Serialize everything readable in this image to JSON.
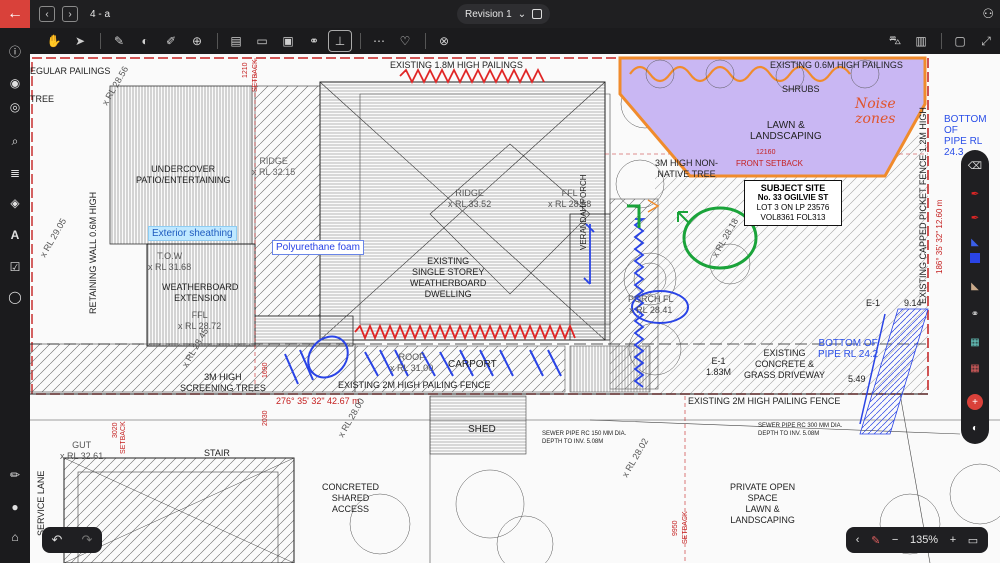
{
  "header": {
    "page_label": "4 - a",
    "revision_label": "Revision 1"
  },
  "plan": {
    "labels": {
      "existing_fence_top": "EXISTING 1.8M HIGH PAILINGS",
      "regular_pailings": "EGULAR PAILINGS",
      "tree": "TREE",
      "existing_fence_top_right": "EXISTING 0.6M HIGH PAILINGS",
      "shrubs": "SHRUBS",
      "lawn": "LAWN &\nLANDSCAPING",
      "front_setback": "FRONT SETBACK",
      "front_setback_dim": "12160",
      "non_native_tree": "3M HIGH NON-\nNATIVE TREE",
      "undercover": "UNDERCOVER\nPATIO/ENTERTAINING",
      "ridge1": "RIDGE\nx RL 32.15",
      "ridge2": "RIDGE\nx RL 33.52",
      "ffl1": "FFL\nx RL 28.58",
      "tow": "T.O.W\nx RL 31.68",
      "weatherboard_ext": "WEATHERBOARD\nEXTENSION",
      "ffl2": "FFL\nx RL 28.72",
      "existing_dwelling": "EXISTING\nSINGLE STOREY\nWEATHERBOARD\nDWELLING",
      "verandah": "VERANDAH/PORCH",
      "porch_fl": "PORCH FL\nx RL 28.41",
      "retaining_wall": "RETAINING WALL 0.6M HIGH",
      "rl_2905": "x RL 29.05",
      "roof": "ROOF\nx RL 31.00",
      "carport": "CARPORT",
      "screening_trees": "3M HIGH\nSCREENING TREES",
      "existing_fence_mid": "EXISTING 2M HIGH PAILING FENCE",
      "bearing": "276° 35' 32\"  42.67 m",
      "existing_fence_right": "EXISTING 2M HIGH PAILING FENCE",
      "concrete_driveway": "EXISTING\nCONCRETE &\nGRASS DRIVEWAY",
      "e1": "E-1\n1.83M",
      "e1b": "E-1",
      "dim_914": "9.14",
      "dim_549": "5.49",
      "picket_fence": "EXISTING CAPPED PICKET FENCE 1.2M HIGH",
      "rl_2818": "x RL 28.18",
      "shed": "SHED",
      "sewer1": "SEWER PIPE RC 150 MM DIA.\nDEPTH TO INV. 5.08M",
      "sewer2": "SEWER PIPE RC 300 MM DIA.\nDEPTH TO INV. 5.08M",
      "gut": "GUT\nx RL 32.61",
      "stair": "STAIR",
      "concreted_access": "CONCRETED\nSHARED\nACCESS",
      "private_open": "PRIVATE OPEN\nSPACE\nLAWN &\nLANDSCAPING",
      "service_lane": "SERVICE LANE",
      "bottom_pipe1": "BOTTOM OF\nPIPE RL 24.2",
      "bottom_pipe2": "BOTTOM OF\nPIPE RL 24.3",
      "setback": "SETBACK",
      "rl_2802": "x RL 28.02",
      "rl_2800": "x RL 28.00",
      "dim_1210": "1210",
      "dim_3020": "3020",
      "dim_2030": "2030",
      "dim_1690": "1690",
      "dim_9950": "9950",
      "bearing_right": "186° 35' 32\"  12.60 m",
      "rl_2845": "x RL 28.45",
      "rl_2856": "x RL 28.56"
    },
    "subject": {
      "title": "SUBJECT SITE",
      "address": "No. 33 OGILVIE ST",
      "lot": "LOT 3 ON LP 23576",
      "vol": "VOL8361 FOL313"
    },
    "annotations": {
      "exterior_sheathing": "Exterior sheathing",
      "polyurethane_foam": "Polyurethane foam",
      "noise_zones": "Noise\nzones"
    }
  },
  "zoom": {
    "level": "135%"
  },
  "colors": {
    "accent_red": "#d9413a",
    "markup_blue": "#2a44e6",
    "markup_green": "#1aa33a",
    "markup_orange": "#f08b2c",
    "noise_zone_fill": "#c9b7f3"
  }
}
